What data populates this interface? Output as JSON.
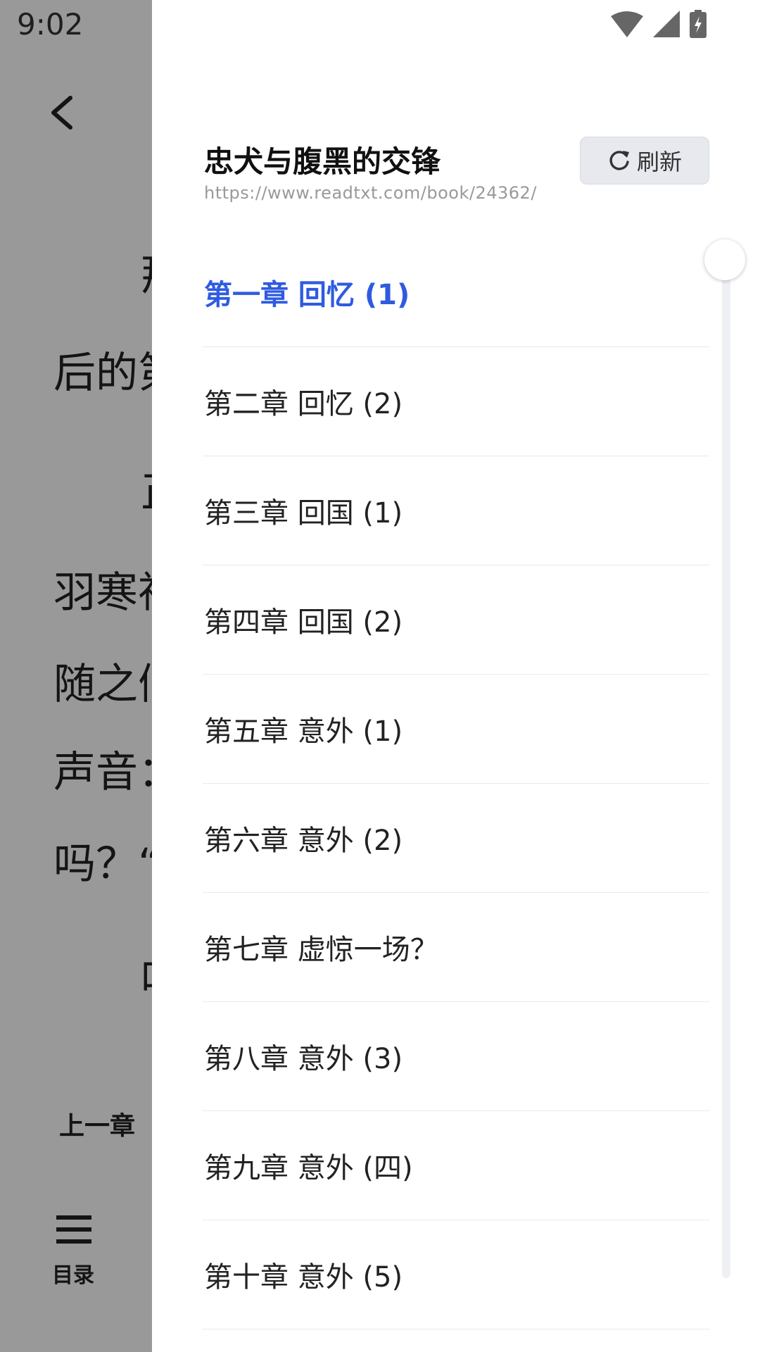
{
  "status_bar": {
    "time": "9:02"
  },
  "reader": {
    "paragraphs": [
      "那",
      "后的第",
      "正",
      "羽寒神",
      "随之们",
      "声音：",
      "吗？“",
      "叮"
    ],
    "prev_chapter_label": "上一章",
    "toc_label": "目录"
  },
  "drawer": {
    "book_title": "忠犬与腹黑的交锋",
    "book_url": "https://www.readtxt.com/book/24362/",
    "refresh_label": "刷新",
    "chapters": [
      {
        "label": "第一章 回忆 (1)",
        "active": true
      },
      {
        "label": "第二章 回忆 (2)",
        "active": false
      },
      {
        "label": "第三章 回国 (1)",
        "active": false
      },
      {
        "label": "第四章 回国 (2)",
        "active": false
      },
      {
        "label": "第五章 意外 (1)",
        "active": false
      },
      {
        "label": "第六章 意外 (2)",
        "active": false
      },
      {
        "label": "第七章 虚惊一场？",
        "active": false
      },
      {
        "label": "第八章 意外 (3)",
        "active": false
      },
      {
        "label": "第九章 意外 (四)",
        "active": false
      },
      {
        "label": "第十章 意外 (5)",
        "active": false
      }
    ],
    "accent_color": "#2f5be0"
  }
}
